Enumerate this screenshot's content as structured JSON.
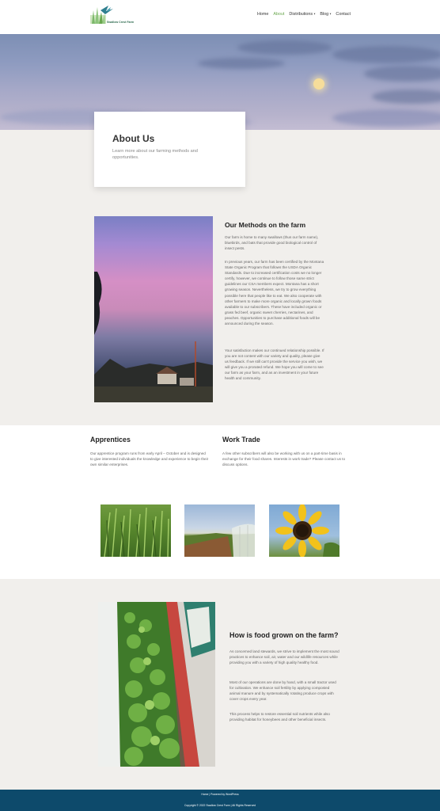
{
  "header": {
    "logo_text": "Swallow Crest Farm",
    "nav": [
      {
        "label": "Home"
      },
      {
        "label": "About"
      },
      {
        "label": "Distributions"
      },
      {
        "label": "Blog"
      },
      {
        "label": "Contact"
      }
    ],
    "active_color": "#6aa84f"
  },
  "about": {
    "title": "About Us",
    "subtitle": "Learn more about our farming methods and opportunities."
  },
  "methods": {
    "title": "Our Methods on the farm",
    "p1": "Our farm is home to many swallows (thus our farm name), bluebirds, and bats that provide good biological control of insect pests.",
    "p2": "In previous years, our farm has been certified by the Montana State Organic Program that follows the USDA Organic Standards. Due to increased certification costs we no longer certify, however, we continue to follow those same strict guidelines our CSA members expect. Montana has a short growing season. Nevertheless, we try to grow everything possible here that people like to eat. We also cooperate with other farmers to make more organic and locally grown foods available to our subscribers. These have included organic or grass fed beef, organic sweet cherries, nectarines, and peaches. Opportunities to purchase additional foods will be announced during the season.",
    "p3": "Your satisfaction makes our continued relationship possible. If you are not content with our variety and quality, please give us feedback. If we still can't provide the service you wish, we will give you a prorated refund. We hope you will come to see our farm as your farm, and as an investment in your future health and community."
  },
  "apprentices": {
    "title": "Apprentices",
    "text": "Our apprentice program runs from early April – October and is designed to give interested individuals the knowledge and experience to begin their own similar enterprises."
  },
  "worktrade": {
    "title": "Work Trade",
    "text": "A few other subscribers will also be working with us on a part-time basis in exchange for their food shares. Interests in work trade? Please contact us to discuss options."
  },
  "food": {
    "title": "How is food grown on the farm?",
    "p1": "As concerned land stewards, we strive to implement the most sound practices to enhance soil, air, water and our wildlife resources while providing you with a variety of high quality healthy food.",
    "p2": "Most of our operations are done by hand, with a small tractor used for cultivation. We enhance soil fertility by applying composted animal manure and by systematically rotating produce crops with cover crops every year.",
    "p3": "This process helps to restore essential soil nutrients while also providing habitat for honeybees and other beneficial insects."
  },
  "footer": {
    "links": "Home | Powered by WordPress",
    "copyright": "Copyright © 2022 Swallow Crest Farm | All Rights Reserved"
  },
  "colors": {
    "beige": "#f1efec",
    "footer": "#0d4a6b",
    "heading": "#222222"
  }
}
